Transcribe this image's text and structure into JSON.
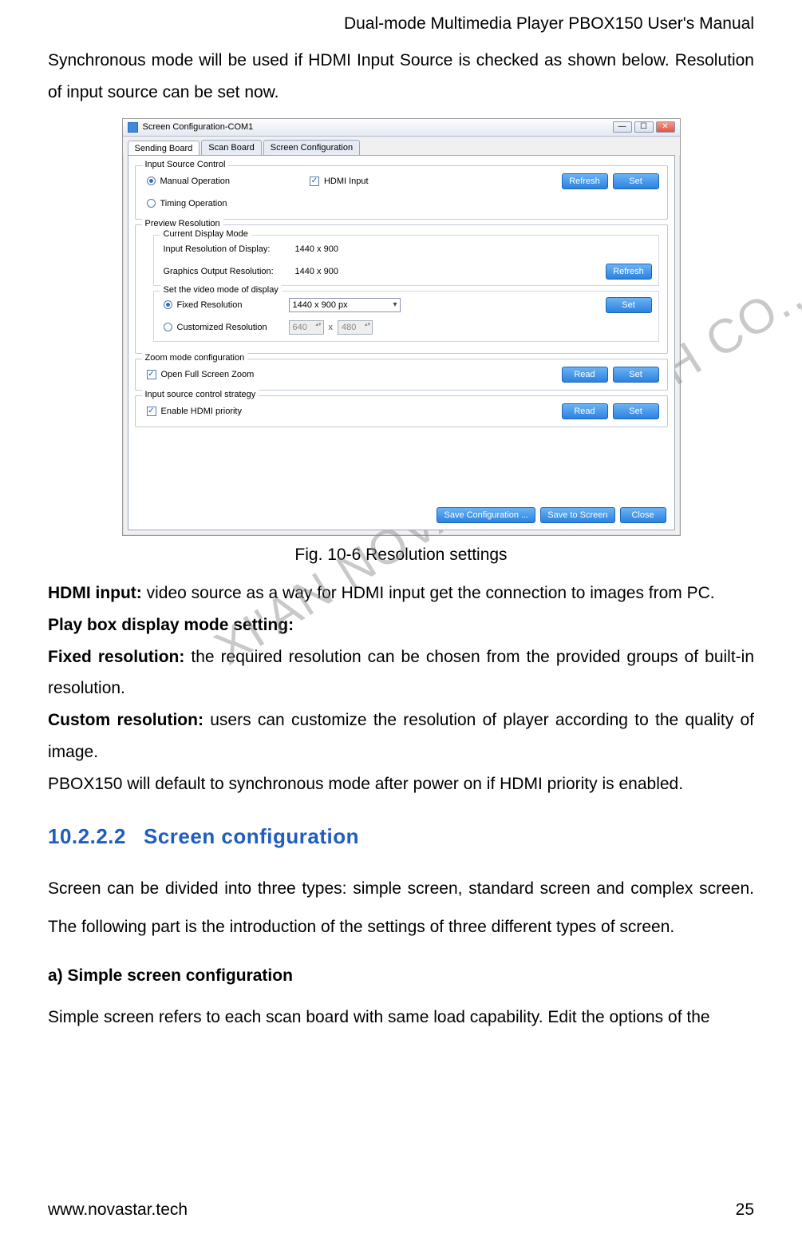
{
  "header": "Dual-mode Multimedia Player PBOX150 User's Manual",
  "watermark": "XI'AN NOVASTAR TECH CO., LTD",
  "intro": "Synchronous mode will be used if HDMI Input Source is checked as shown below. Resolution of input source can be set now.",
  "figcaption": "Fig. 10-6 Resolution settings",
  "body": {
    "hdmi_label": "HDMI input:",
    "hdmi_text": " video source as a way for HDMI input get the connection to images from PC.",
    "play_label": "Play box display mode setting:",
    "fixed_label": "Fixed resolution:",
    "fixed_text": " the required resolution can be chosen from the provided groups of built-in resolution.",
    "custom_label": "Custom resolution:",
    "custom_text": " users can customize the resolution of player according to the quality of image.",
    "priority": "PBOX150 will default to synchronous mode after power on if HDMI priority is enabled."
  },
  "section": {
    "num": "10.2.2.2",
    "title": "Screen configuration"
  },
  "sec_para": "Screen can be divided into three types: simple screen, standard screen and complex screen. The following part is the introduction of the settings of three different types of screen.",
  "sub_a": "a)    Simple screen configuration",
  "sub_a_text": "Simple screen refers to each scan board with same load capability.  Edit the options of the",
  "footer": {
    "left": "www.novastar.tech",
    "right": "25"
  },
  "shot": {
    "title": "Screen Configuration-COM1",
    "tabs": {
      "t1": "Sending Board",
      "t2": "Scan Board",
      "t3": "Screen Configuration"
    },
    "isc": {
      "title": "Input Source Control",
      "manual": "Manual Operation",
      "timing": "Timing Operation",
      "hdmi": "HDMI Input",
      "refresh": "Refresh",
      "set": "Set"
    },
    "pr": {
      "title": "Preview Resolution",
      "cdm": "Current Display Mode",
      "in_label": "Input Resolution of Display:",
      "in_val": "1440 x 900",
      "out_label": "Graphics Output Resolution:",
      "out_val": "1440 x 900",
      "refresh": "Refresh",
      "svm": "Set the video mode of display",
      "fixed": "Fixed Resolution",
      "fixed_val": "1440 x 900 px",
      "custom": "Customized Resolution",
      "cw": "640",
      "ch": "480",
      "set": "Set"
    },
    "zoom": {
      "title": "Zoom mode configuration",
      "open": "Open Full Screen Zoom",
      "read": "Read",
      "set": "Set"
    },
    "strategy": {
      "title": "Input source control strategy",
      "enable": "Enable HDMI priority",
      "read": "Read",
      "set": "Set"
    },
    "bottom": {
      "savecfg": "Save Configuration ...",
      "savescr": "Save to Screen",
      "close": "Close"
    }
  }
}
